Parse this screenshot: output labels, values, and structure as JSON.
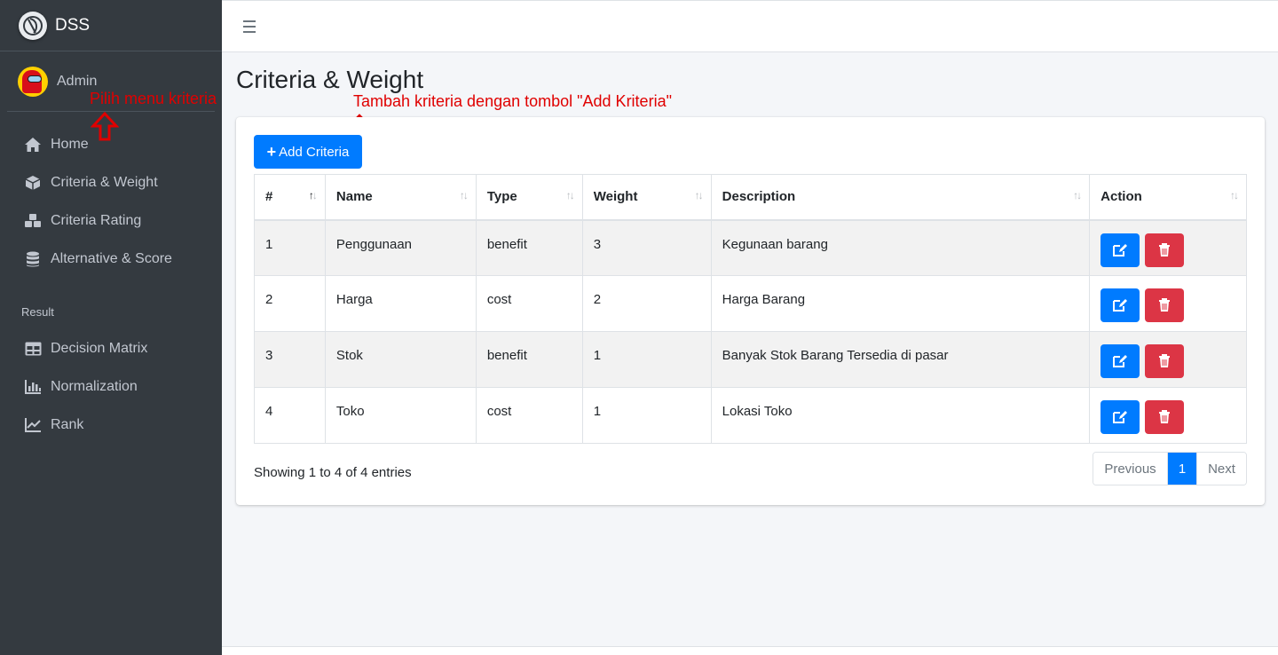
{
  "brand": {
    "name": "DSS"
  },
  "user": {
    "name": "Admin"
  },
  "sidebar": {
    "items": [
      {
        "label": "Home",
        "icon": "home-icon"
      },
      {
        "label": "Criteria & Weight",
        "icon": "cube-icon"
      },
      {
        "label": "Criteria Rating",
        "icon": "cubes-icon"
      },
      {
        "label": "Alternative & Score",
        "icon": "database-icon"
      }
    ],
    "section_header": "Result",
    "result_items": [
      {
        "label": "Decision Matrix",
        "icon": "table-icon"
      },
      {
        "label": "Normalization",
        "icon": "bar-chart-icon"
      },
      {
        "label": "Rank",
        "icon": "line-chart-icon"
      }
    ]
  },
  "page": {
    "title": "Criteria & Weight"
  },
  "annotations": {
    "menu": "Pilih menu kriteria",
    "add": "Tambah kriteria dengan tombol \"Add Kriteria\""
  },
  "toolbar": {
    "add_label": "Add Criteria"
  },
  "table": {
    "columns": [
      "#",
      "Name",
      "Type",
      "Weight",
      "Description",
      "Action"
    ],
    "rows": [
      {
        "no": "1",
        "name": "Penggunaan",
        "type": "benefit",
        "weight": "3",
        "description": "Kegunaan barang"
      },
      {
        "no": "2",
        "name": "Harga",
        "type": "cost",
        "weight": "2",
        "description": "Harga Barang"
      },
      {
        "no": "3",
        "name": "Stok",
        "type": "benefit",
        "weight": "1",
        "description": "Banyak Stok Barang Tersedia di pasar"
      },
      {
        "no": "4",
        "name": "Toko",
        "type": "cost",
        "weight": "1",
        "description": "Lokasi Toko"
      }
    ]
  },
  "footer": {
    "info": "Showing 1 to 4 of 4 entries",
    "pagination": {
      "previous": "Previous",
      "current": "1",
      "next": "Next"
    }
  },
  "colors": {
    "primary": "#007bff",
    "danger": "#dc3545",
    "sidebar": "#343a40",
    "annotation": "#e00000"
  }
}
